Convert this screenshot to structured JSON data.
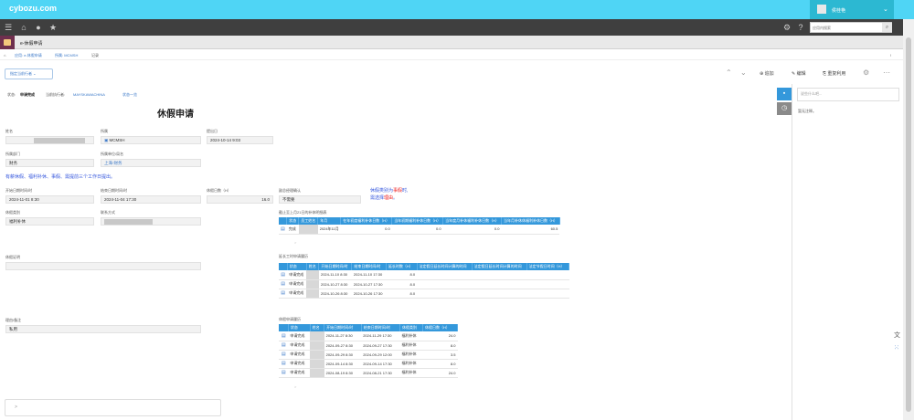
{
  "header": {
    "logo": "cybozu.com",
    "user": "侯桂艳",
    "search_placeholder": "应用内搜索"
  },
  "app": {
    "title": "e-休假申请"
  },
  "breadcrumb": {
    "b1": "应用: e-休假申请",
    "b2": "所属: MCMSH",
    "b3": "记录"
  },
  "actions": {
    "workflow_btn": "指定当前行者",
    "add": "追加",
    "edit": "编辑",
    "reuse": "重复利用"
  },
  "status": {
    "label": "状态:",
    "value": "申请完成",
    "assignee_label": "当前执行者:",
    "assignee": "MAYSKAWACHINA",
    "history": "状态一览"
  },
  "form": {
    "title": "休假申请",
    "name_label": "姓名",
    "dept_label": "所属",
    "dept_value": "MCMSH",
    "submit_label": "提出日",
    "submit_value": "2024-10-14 9:03",
    "section_label": "所属部门",
    "section_value": "财务",
    "office_label": "所属单位/局名",
    "office_value": "上海-财务",
    "notice": "有薪休假、福利补休、事假、需提前三个工作日提出。",
    "start_label": "开始日期时间/时",
    "start_value": "2024-11-01 8:30",
    "end_label": "结束日期时间/时",
    "end_value": "2024-11-04 17:30",
    "days_label": "休假日数（H）",
    "days_value": "16.0",
    "confirm_label": "副总经理确认",
    "confirm_value": "不需要",
    "type_label": "休假类别",
    "type_value": "福利补休",
    "contact_label": "联系方式",
    "proof_label": "休假证明",
    "reason_label": "理由/备注",
    "reason_value": "私用",
    "tip_line1_a": "休假类别为",
    "tip_line1_b": "事假",
    "tip_line1_c": "时,",
    "tip_line2_a": "需选择",
    "tip_line2_b": "理由",
    "tip_line2_c": "。"
  },
  "table1": {
    "title": "截止至上月21日的补休明细表",
    "headers": [
      "状态",
      "员工姓名",
      "年月",
      "在年初度福利补休日数（H）",
      "当年初期福利补休日数（H）",
      "当年度月补休福利补休日数（H）",
      "当年月补休休福利补休日数（H）"
    ],
    "rows": [
      {
        "status": "完成",
        "period": "2024年11月",
        "v1": "0.0",
        "v2": "0.0",
        "v3": "0.0",
        "v4": "60.5"
      }
    ]
  },
  "table2": {
    "title": "延长工时申请履历",
    "headers": [
      "状态",
      "姓名",
      "开始日期时间/时",
      "结束日期时间/时",
      "延长时数（H）",
      "法定假日延长时间计算的时间",
      "法定假日延长时间计算的时间",
      "法定节假日时间（H）"
    ],
    "rows": [
      {
        "status": "申请完成",
        "start": "2024-11-10 8:30",
        "end": "2024-11-10 17:30",
        "hours": "8.0"
      },
      {
        "status": "申请完成",
        "start": "2024-10-27 8:30",
        "end": "2024-10-27 17:30",
        "hours": "8.0"
      },
      {
        "status": "申请完成",
        "start": "2024-10-26 8:30",
        "end": "2024-10-26 17:30",
        "hours": "8.0"
      }
    ]
  },
  "table3": {
    "title": "休假申请履历",
    "headers": [
      "状态",
      "姓名",
      "开始日期时间/时",
      "结束日期时间/时",
      "休假类别",
      "休假日数（H）"
    ],
    "rows": [
      {
        "status": "申请完成",
        "start": "2024-11-27 8:30",
        "end": "2024-11-29 17:30",
        "type": "福利补休",
        "days": "24.0"
      },
      {
        "status": "申请完成",
        "start": "2024-09-27 8:30",
        "end": "2024-09-27 17:30",
        "type": "福利补休",
        "days": "8.0"
      },
      {
        "status": "申请完成",
        "start": "2024-09-29 8:30",
        "end": "2024-09-29 12:00",
        "type": "福利补休",
        "days": "3.5"
      },
      {
        "status": "申请完成",
        "start": "2024-09-14 8:30",
        "end": "2024-09-14 17:30",
        "type": "福利补休",
        "days": "8.0"
      },
      {
        "status": "申请完成",
        "start": "2024-08-19 8:30",
        "end": "2024-08-21 17:30",
        "type": "福利补休",
        "days": "24.0"
      }
    ]
  },
  "side": {
    "comment_placeholder": "说些什么吧...",
    "empty": "暂无注释。"
  }
}
